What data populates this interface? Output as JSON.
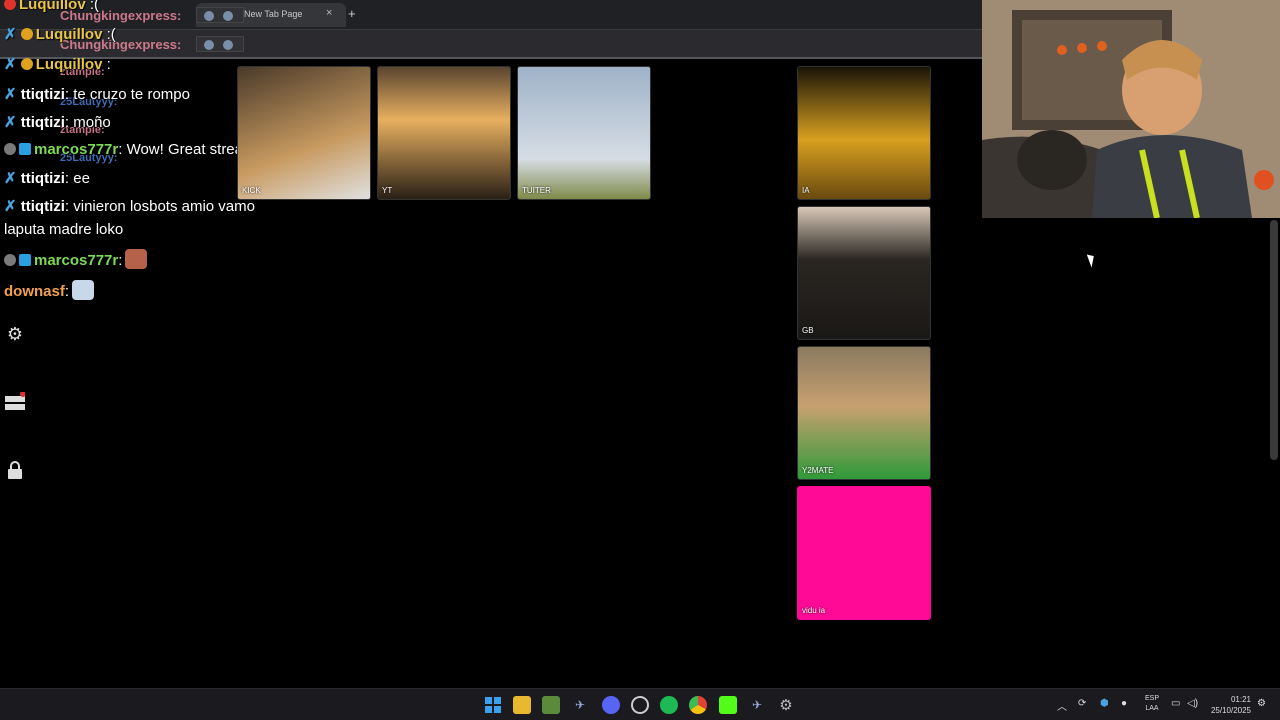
{
  "browser": {
    "tab_title": "New Tab Page",
    "tab_close": "×",
    "new_tab": "+"
  },
  "chat": {
    "ghost_names": [
      "Chungkingexpress:",
      "Chungkingexpress:",
      "ztample:",
      "25Lautyyy:",
      "ztample:",
      "25Lautyyy:"
    ],
    "messages": [
      {
        "name": "Luquillov",
        "text": " :(",
        "color": "#e8c447",
        "badge": "#e0332b"
      },
      {
        "name": "Luquillov",
        "text": " :(",
        "color": "#e8c447",
        "badge": "#e0a020"
      },
      {
        "name": "Luquillov",
        "text": " :",
        "color": "#e8c447",
        "badge": "#e0a020"
      },
      {
        "name": "ttiqtizi",
        "text": ": te cruzo te rompo",
        "color": "#ffffff",
        "badge": "#4aa3e0"
      },
      {
        "name": "ttiqtizi",
        "text": ": moño",
        "color": "#ffffff",
        "badge": "#4aa3e0"
      },
      {
        "name": "marcos777r",
        "text": ": Wow! Great stream!",
        "color": "#7ed957",
        "badge": "#7a7a7a"
      },
      {
        "name": "ttiqtizi",
        "text": ": ee",
        "color": "#ffffff",
        "badge": "#4aa3e0"
      },
      {
        "name": "ttiqtizi",
        "text": ": vinieron losbots amio vamo",
        "color": "#ffffff",
        "badge": "#4aa3e0"
      },
      {
        "name": "",
        "text": "laputa madre loko",
        "color": "#ffffff",
        "badge": ""
      },
      {
        "name": "marcos777r",
        "text": ":",
        "color": "#7ed957",
        "badge": "#7a7a7a"
      },
      {
        "name": "downasf",
        "text": ":",
        "color": "#f0a050",
        "badge": ""
      }
    ]
  },
  "side_icons": [
    "gear-icon",
    "layers-icon",
    "lock-icon"
  ],
  "cards": [
    {
      "label": "KICK",
      "color_a": "#7a5a3a",
      "color_b": "#d9a86b"
    },
    {
      "label": "YT",
      "color_a": "#3a2a1a",
      "color_b": "#e8b060"
    },
    {
      "label": "TUITER",
      "color_a": "#9fb2c8",
      "color_b": "#c9d3dd"
    },
    {
      "label": "IA",
      "color_a": "#2a2010",
      "color_b": "#d8a020"
    },
    {
      "label": "GB",
      "color_a": "#2a2622",
      "color_b": "#b8a898"
    },
    {
      "label": "Y2MATE",
      "color_a": "#2f7a3a",
      "color_b": "#c8a060"
    },
    {
      "label": "vidu ia",
      "color_a": "#ff0a96",
      "color_b": "#ff0a96"
    }
  ],
  "taskbar": {
    "apps": [
      "windows-start-icon",
      "file-explorer-icon",
      "minecraft-icon",
      "steam-icon",
      "discord-icon",
      "obs-icon",
      "spotify-icon",
      "chrome-icon",
      "kick-icon",
      "steam-2-icon",
      "settings-icon"
    ],
    "tray_icons": [
      "chevron-up-icon",
      "sync-icon",
      "shield-icon",
      "mic-icon"
    ],
    "lang_line1": "ESP",
    "lang_line2": "LAA",
    "time": "01:21",
    "date": "25/10/2025"
  }
}
